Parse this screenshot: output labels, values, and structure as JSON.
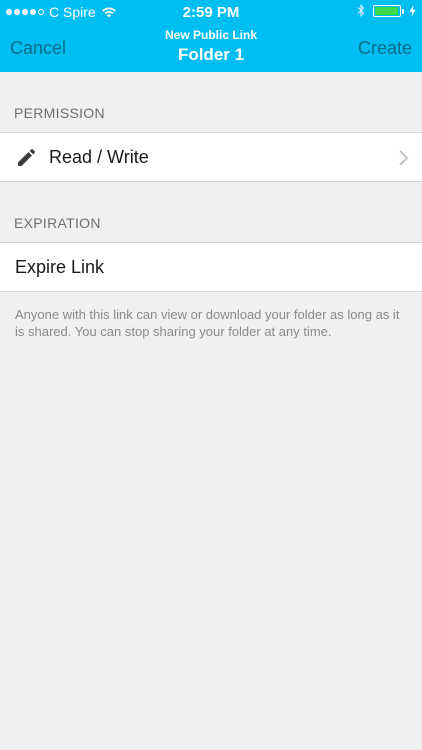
{
  "status_bar": {
    "carrier": "C Spire",
    "time": "2:59 PM",
    "battery_fraction": 0.95
  },
  "nav": {
    "cancel_label": "Cancel",
    "subtitle": "New Public Link",
    "title": "Folder 1",
    "create_label": "Create"
  },
  "permission": {
    "header": "PERMISSION",
    "value": "Read / Write",
    "icon": "pencil-icon"
  },
  "expiration": {
    "header": "EXPIRATION",
    "expire_label": "Expire Link"
  },
  "note": "Anyone with this link can view or download your folder as long as it is shared. You can stop sharing your folder at any time.",
  "colors": {
    "nav_bg": "#00bdf2",
    "nav_button": "#0a6e8b",
    "battery": "#3adb4b"
  }
}
